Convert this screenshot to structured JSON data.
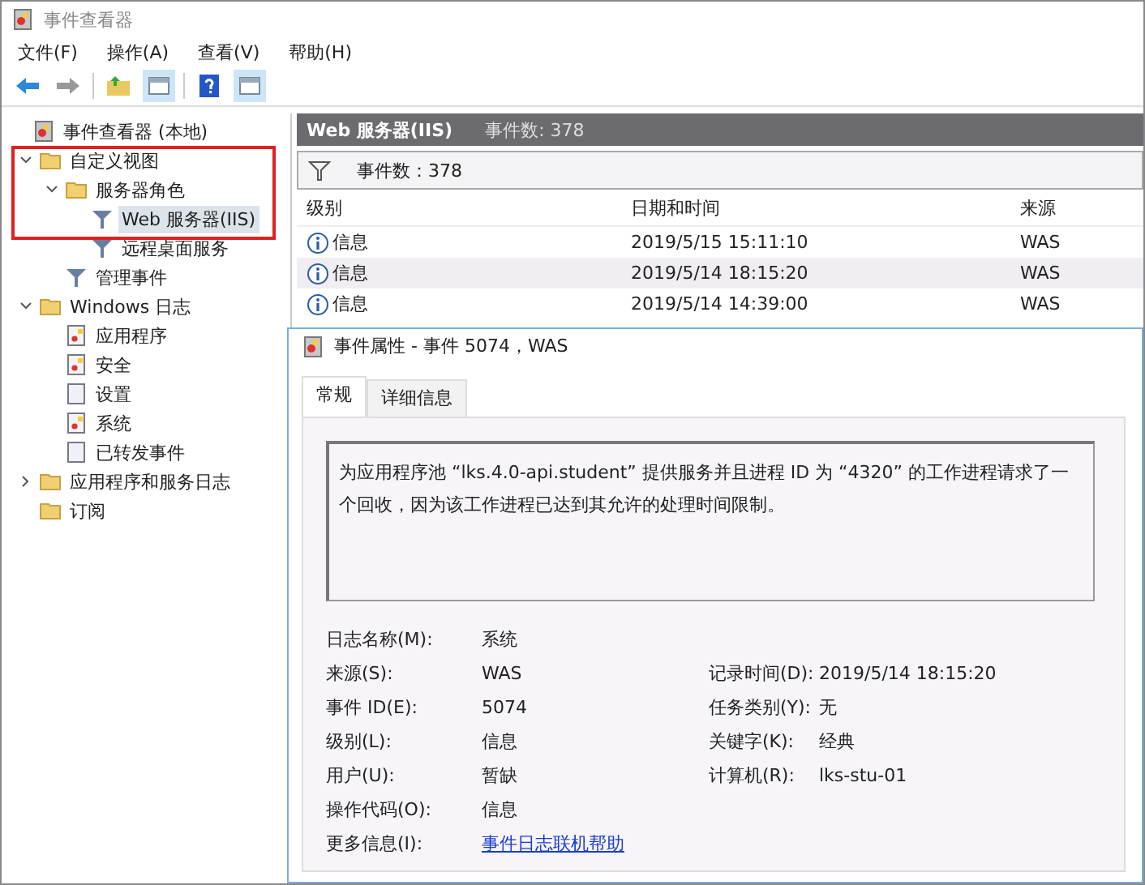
{
  "window": {
    "title": "事件查看器"
  },
  "menu": [
    "文件(F)",
    "操作(A)",
    "查看(V)",
    "帮助(H)"
  ],
  "tree": [
    {
      "label": "事件查看器 (本地)",
      "kind": "viewer",
      "children": [
        {
          "label": "自定义视图",
          "kind": "folder",
          "expanded": true,
          "children": [
            {
              "label": "服务器角色",
              "kind": "folder",
              "expanded": true,
              "children": [
                {
                  "label": "Web 服务器(IIS)",
                  "kind": "filter",
                  "selected": true
                },
                {
                  "label": "远程桌面服务",
                  "kind": "filter",
                  "selected": false
                }
              ]
            },
            {
              "label": "管理事件",
              "kind": "filter",
              "selected": false
            }
          ]
        },
        {
          "label": "Windows 日志",
          "kind": "folder",
          "expanded": true,
          "children": [
            {
              "label": "应用程序",
              "kind": "log",
              "selected": false
            },
            {
              "label": "安全",
              "kind": "log",
              "selected": false
            },
            {
              "label": "设置",
              "kind": "blank",
              "selected": false
            },
            {
              "label": "系统",
              "kind": "log",
              "selected": false
            },
            {
              "label": "已转发事件",
              "kind": "blank",
              "selected": false
            }
          ]
        },
        {
          "label": "应用程序和服务日志",
          "kind": "folder",
          "expanded": false
        },
        {
          "label": "订阅",
          "kind": "folder",
          "selected": false
        }
      ]
    }
  ],
  "pane": {
    "title": "Web 服务器(IIS)",
    "count": "事件数: 378",
    "filter": "事件数：378",
    "columns": [
      "级别",
      "日期和时间",
      "来源"
    ],
    "rows": [
      {
        "level": "信息",
        "time": "2019/5/15 15:11:10",
        "source": "WAS",
        "selected": false
      },
      {
        "level": "信息",
        "time": "2019/5/14 18:15:20",
        "source": "WAS",
        "selected": true
      },
      {
        "level": "信息",
        "time": "2019/5/14 14:39:00",
        "source": "WAS",
        "selected": false
      }
    ]
  },
  "dialog": {
    "title": "事件属性 - 事件 5074，WAS",
    "tabs": [
      {
        "label": "常规",
        "selected": true
      },
      {
        "label": "详细信息",
        "selected": false
      }
    ],
    "description": "为应用程序池 “lks.4.0-api.student” 提供服务并且进程 ID 为 “4320” 的工作进程请求了一个回收，因为该工作进程已达到其允许的处理时间限制。",
    "fields": [
      {
        "label": "日志名称(M):",
        "value": "系统"
      },
      {
        "label": "来源(S):",
        "value": "WAS",
        "label2": "记录时间(D):",
        "value2": "2019/5/14 18:15:20"
      },
      {
        "label": "事件 ID(E):",
        "value": "5074",
        "label2": "任务类别(Y):",
        "value2": "无"
      },
      {
        "label": "级别(L):",
        "value": "信息",
        "label2": "关键字(K):",
        "value2": "经典"
      },
      {
        "label": "用户(U):",
        "value": "暂缺",
        "label2": "计算机(R):",
        "value2": "lks-stu-01"
      },
      {
        "label": "操作代码(O):",
        "value": "信息"
      },
      {
        "label": "更多信息(I):",
        "value": "事件日志联机帮助",
        "kind": "link"
      }
    ]
  }
}
